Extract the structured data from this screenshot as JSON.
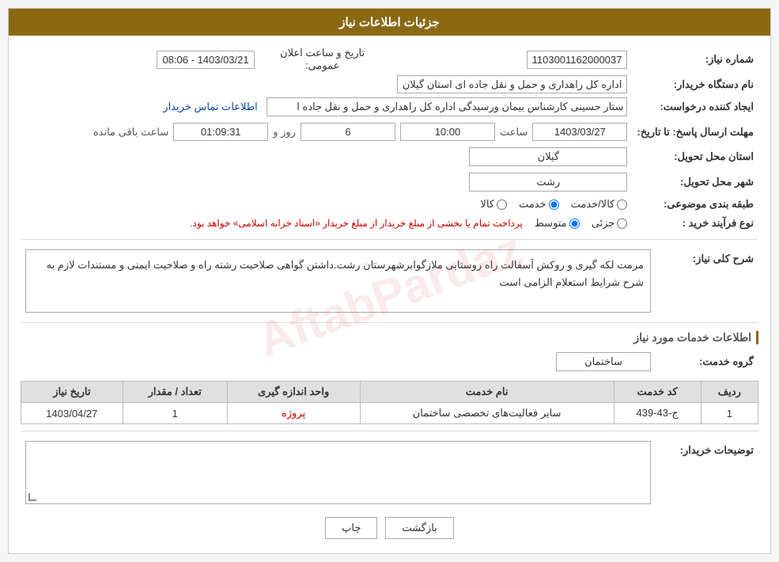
{
  "header": {
    "title": "جزئیات اطلاعات نیاز"
  },
  "fields": {
    "shomara_niaz_label": "شماره نیاز:",
    "shomara_niaz_value": "1103001162000037",
    "nam_dastgah_label": "نام دستگاه خریدار:",
    "nam_dastgah_value": "اداره کل راهداری و حمل و نقل جاده ای استان گیلان",
    "ijad_label": "ایجاد کننده درخواست:",
    "ijad_value": "ستار حسینی کارشناس بیمان ورسیدگی اداره کل راهداری و حمل و نقل جاده ا",
    "ijad_link": "اطلاعات تماس خریدار",
    "mohlet_label": "مهلت ارسال پاسخ: تا تاریخ:",
    "mohlet_date": "1403/03/27",
    "mohlet_saat_label": "ساعت",
    "mohlet_saat": "10:00",
    "mohlet_roz_label": "روز و",
    "mohlet_roz": "6",
    "mohlet_time": "01:09:31",
    "mohlet_mande": "ساعت باقی مانده",
    "ostan_label": "استان محل تحویل:",
    "ostan_value": "گیلان",
    "shahr_label": "شهر محل تحویل:",
    "shahr_value": "رشت",
    "tabaqe_label": "طبقه بندی موضوعی:",
    "radio_kala": "کالا",
    "radio_khedmat": "خدمت",
    "radio_kala_khedmat": "کالا/خدمت",
    "selected_tabaqe": "khedmat",
    "nooe_farayand_label": "نوع فرآیند خرید :",
    "radio_jozi": "جزئی",
    "radio_motevaset": "متوسط",
    "radio_selected": "motevaset",
    "farayand_desc": "پرداخت تمام یا بخشی از مبلغ خریدار از مبلغ خریدار «اسناد خزانه اسلامی» خواهد بود.",
    "sharh_label": "شرح کلی نیاز:",
    "sharh_value": "مرمت لکه گیری و روکش آسفالت راه روستایی ملازگوابرشهرستان رشت.داشتن گواهی صلاحیت رشته راه و صلاحیت ایمنی و مستندات لازم به شرح شرایط استعلام الزامی است",
    "khadamat_label": "اطلاعات خدمات مورد نیاز",
    "gorooh_label": "گروه خدمت:",
    "gorooh_value": "ساختمان",
    "table_headers": [
      "ردیف",
      "کد خدمت",
      "نام خدمت",
      "واحد اندازه گیری",
      "تعداد / مقدار",
      "تاریخ نیاز"
    ],
    "table_rows": [
      {
        "radif": "1",
        "kod_khedmat": "ج-43-439",
        "nam_khedmat": "سایر فعالیت‌های تخصصی ساختمان",
        "vahed": "پروژه",
        "tedad": "1",
        "tarikh": "1403/04/27"
      }
    ],
    "tozihat_label": "توضیحات خریدار:",
    "tozihat_value": "",
    "btn_back": "بازگشت",
    "btn_print": "چاپ"
  }
}
